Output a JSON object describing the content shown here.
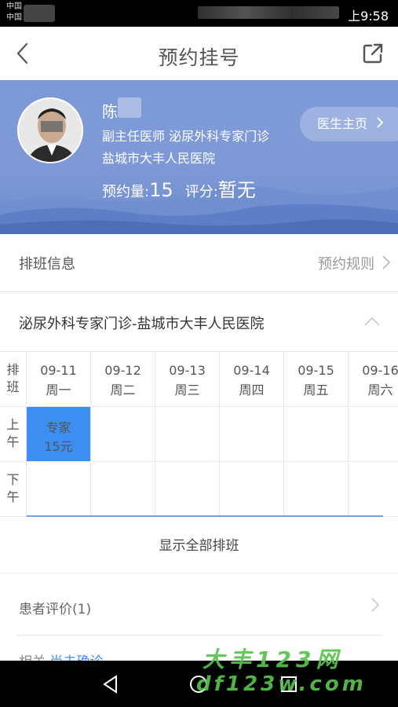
{
  "status_bar": {
    "carrier_line1": "中国",
    "carrier_line2": "中国",
    "time": "上9:58"
  },
  "header": {
    "title": "预约挂号"
  },
  "doctor": {
    "name": "陈",
    "title_dept": "副主任医师  泌尿外科专家门诊",
    "hospital": "盐城市大丰人民医院",
    "booking_label": "预约量:",
    "booking_count": "15",
    "score_label": "评分:",
    "score_value": "暂无",
    "homepage_button": "医生主页"
  },
  "schedule_info": {
    "label": "排班信息",
    "rules_link": "预约规则"
  },
  "clinic": {
    "label": "泌尿外科专家门诊-盐城市大丰人民医院"
  },
  "schedule": {
    "side_header": "排\n班",
    "rows": [
      {
        "label": "上\n午"
      },
      {
        "label": "下\n午"
      }
    ],
    "days": [
      {
        "date": "09-11",
        "weekday": "周一"
      },
      {
        "date": "09-12",
        "weekday": "周二"
      },
      {
        "date": "09-13",
        "weekday": "周三"
      },
      {
        "date": "09-14",
        "weekday": "周四"
      },
      {
        "date": "09-15",
        "weekday": "周五"
      },
      {
        "date": "09-16",
        "weekday": "周六"
      }
    ],
    "slot": {
      "type": "专家",
      "price": "15元"
    },
    "slot_color": "#3c8ef0"
  },
  "show_all": "显示全部排班",
  "review": {
    "label": "患者评价(1)"
  },
  "cut_off": {
    "prefix": "相关",
    "link": "尚未确诊"
  },
  "watermark": {
    "line1": "大丰123网",
    "line2": "df123w.com"
  },
  "colors": {
    "banner": "#7d9ad8",
    "accent": "#3c8ef0",
    "watermark": "#56c34b"
  }
}
